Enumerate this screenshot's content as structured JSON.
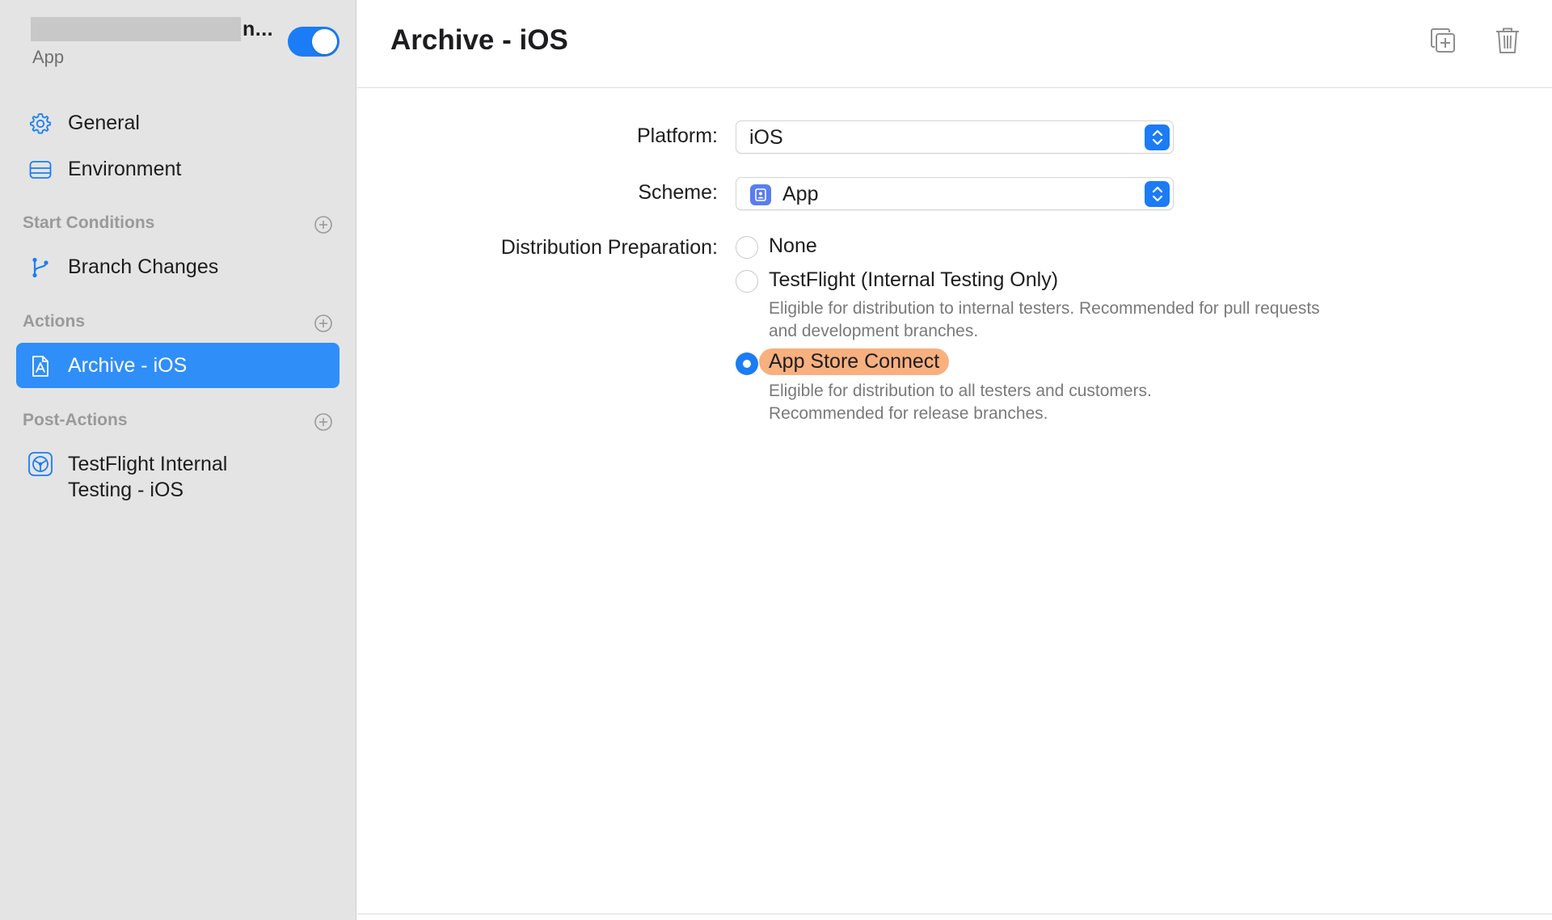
{
  "workflow": {
    "name_suffix": "n...",
    "subtitle": "App",
    "enabled": true
  },
  "sidebar": {
    "items": [
      {
        "label": "General",
        "icon": "gear-icon"
      },
      {
        "label": "Environment",
        "icon": "server-icon"
      }
    ],
    "sections": [
      {
        "title": "Start Conditions",
        "items": [
          {
            "label": "Branch Changes",
            "icon": "branch-icon"
          }
        ]
      },
      {
        "title": "Actions",
        "items": [
          {
            "label": "Archive - iOS",
            "icon": "archive-app-icon",
            "selected": true
          }
        ]
      },
      {
        "title": "Post-Actions",
        "items": [
          {
            "label": "TestFlight Internal Testing - iOS",
            "line1": "TestFlight Internal",
            "line2": "Testing - iOS",
            "icon": "testflight-icon"
          }
        ]
      }
    ]
  },
  "main": {
    "title": "Archive - iOS",
    "form": {
      "platform_label": "Platform:",
      "platform_value": "iOS",
      "scheme_label": "Scheme:",
      "scheme_value": "App",
      "distribution_label": "Distribution Preparation:",
      "options": [
        {
          "label": "None",
          "selected": false
        },
        {
          "label": "TestFlight (Internal Testing Only)",
          "selected": false,
          "desc_line1": "Eligible for distribution to internal testers. Recommended for pull requests",
          "desc_line2": "and development branches."
        },
        {
          "label": "App Store Connect",
          "selected": true,
          "desc_line1": "Eligible for distribution to all testers and customers.",
          "desc_line2": "Recommended for release branches."
        }
      ]
    }
  },
  "colors": {
    "accent": "#1b7cf5",
    "selection": "#2f8ef8",
    "highlight": "#f8b07f",
    "sidebar_bg": "#e4e4e4"
  }
}
